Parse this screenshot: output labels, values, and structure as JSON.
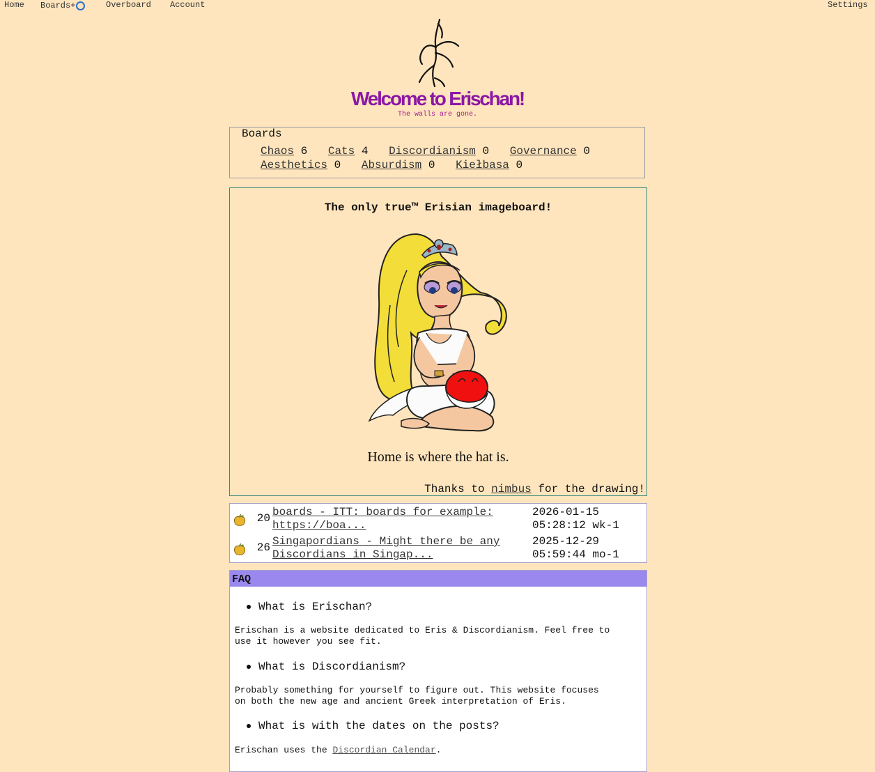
{
  "topnav": {
    "home": "Home",
    "boards": "Boards+",
    "overboard": "Overboard",
    "account": "Account",
    "settings": "Settings"
  },
  "header": {
    "title": "Welcome to Erischan!",
    "subtitle": "The walls are gone."
  },
  "boards": {
    "legend": "Boards",
    "row1": [
      {
        "name": "Chaos",
        "count": "6"
      },
      {
        "name": "Cats",
        "count": "4"
      },
      {
        "name": "Discordianism",
        "count": "0"
      },
      {
        "name": "Governance",
        "count": "0"
      }
    ],
    "row2": [
      {
        "name": "Aesthetics",
        "count": "0"
      },
      {
        "name": "Absurdism",
        "count": "0"
      },
      {
        "name": "Kiełbasa",
        "count": "0"
      }
    ]
  },
  "welcome": {
    "heading": "The only true™ Erisian imageboard!",
    "motto": "Home is where the hat is.",
    "credit_prefix": "Thanks to",
    "credit_link": "nimbus",
    "credit_suffix": "for the drawing!"
  },
  "threads": [
    {
      "replies": "20",
      "title_line1": "boards - ITT: boards for example:",
      "title_line2": "https://boa...",
      "date_line1": "2026-01-15",
      "date_line2": "05:28:12 wk-1"
    },
    {
      "replies": "26",
      "title_line1": "Singapordians - Might there be any",
      "title_line2": "Discordians in Singap...",
      "date_line1": "2025-12-29",
      "date_line2": "05:59:44 mo-1"
    }
  ],
  "faq": {
    "header": "FAQ",
    "items": [
      {
        "q": "What is Erischan?",
        "a_line1": "Erischan is a website dedicated to Eris & Discordianism. Feel free to",
        "a_line2": "use it however you see fit."
      },
      {
        "q": "What is Discordianism?",
        "a_line1": "Probably something for yourself to figure out. This website focuses",
        "a_line2": "on both the new age and ancient Greek interpretation of Eris."
      },
      {
        "q": "What is with the dates on the posts?",
        "a_prefix": "Erischan uses the",
        "a_link": "Discordian Calendar",
        "a_suffix": "."
      }
    ]
  },
  "colors": {
    "background": "#ffe5bd",
    "title": "#8c17a6",
    "faq_header": "#9a88ee",
    "link": "#333333"
  },
  "icons": [
    "ring-icon",
    "erischan-logo-icon",
    "golden-apple-icon"
  ]
}
